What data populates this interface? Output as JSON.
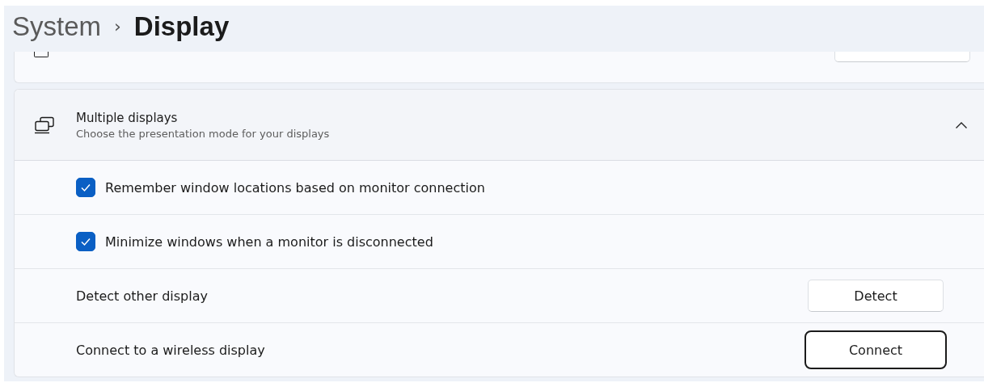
{
  "breadcrumb": {
    "parent": "System",
    "separator": "›",
    "current": "Display"
  },
  "section": {
    "title": "Multiple displays",
    "subtitle": "Choose the presentation mode for your displays",
    "expanded": true
  },
  "rows": [
    {
      "kind": "checkbox",
      "label": "Remember window locations based on monitor connection",
      "checked": true
    },
    {
      "kind": "checkbox",
      "label": "Minimize windows when a monitor is disconnected",
      "checked": true
    },
    {
      "kind": "button",
      "label": "Detect other display",
      "button": "Detect",
      "focused": false
    },
    {
      "kind": "button",
      "label": "Connect to a wireless display",
      "button": "Connect",
      "focused": true
    }
  ]
}
